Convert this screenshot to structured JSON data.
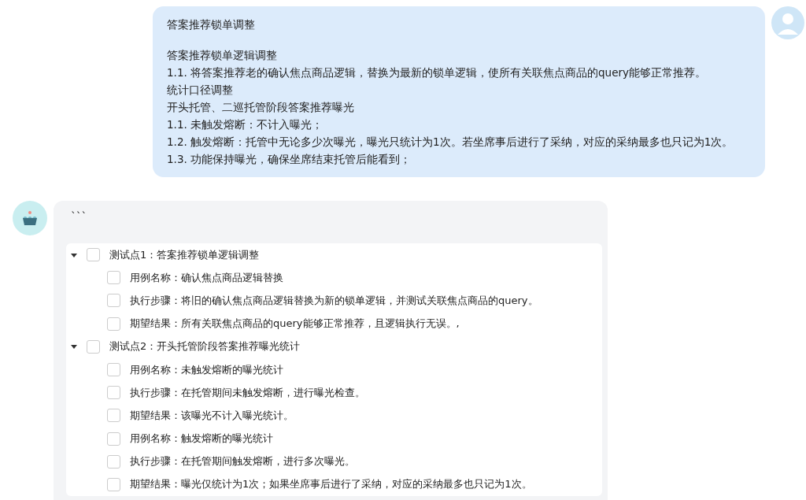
{
  "user_message": {
    "title": "答案推荐锁单调整",
    "lines": [
      "答案推荐锁单逻辑调整",
      "1.1. 将答案推荐老的确认焦点商品逻辑，替换为最新的锁单逻辑，使所有关联焦点商品的query能够正常推荐。",
      "统计口径调整",
      "开头托管、二巡托管阶段答案推荐曝光",
      "1.1. 未触发熔断：不计入曝光；",
      "1.2. 触发熔断：托管中无论多少次曝光，曝光只统计为1次。若坐席事后进行了采纳，对应的采纳最多也只记为1次。",
      "1.3. 功能保持曝光，确保坐席结束托管后能看到；"
    ]
  },
  "bot_message": {
    "code_fence": "```",
    "checklist": [
      {
        "text": "测试点1：答案推荐锁单逻辑调整",
        "checked": false,
        "expanded": true,
        "children": [
          {
            "text": "用例名称：确认焦点商品逻辑替换",
            "checked": false
          },
          {
            "text": "执行步骤：将旧的确认焦点商品逻辑替换为新的锁单逻辑，并测试关联焦点商品的query。",
            "checked": false
          },
          {
            "text": "期望结果：所有关联焦点商品的query能够正常推荐，且逻辑执行无误。,",
            "checked": false
          }
        ]
      },
      {
        "text": "测试点2：开头托管阶段答案推荐曝光统计",
        "checked": false,
        "expanded": true,
        "children": [
          {
            "text": "用例名称：未触发熔断的曝光统计",
            "checked": false
          },
          {
            "text": "执行步骤：在托管期间未触发熔断，进行曝光检查。",
            "checked": false
          },
          {
            "text": "期望结果：该曝光不计入曝光统计。",
            "checked": false
          },
          {
            "text": "用例名称：触发熔断的曝光统计",
            "checked": false
          },
          {
            "text": "执行步骤：在托管期间触发熔断，进行多次曝光。",
            "checked": false
          },
          {
            "text": "期望结果：曝光仅统计为1次；如果坐席事后进行了采纳，对应的采纳最多也只记为1次。",
            "checked": false
          }
        ]
      }
    ]
  }
}
